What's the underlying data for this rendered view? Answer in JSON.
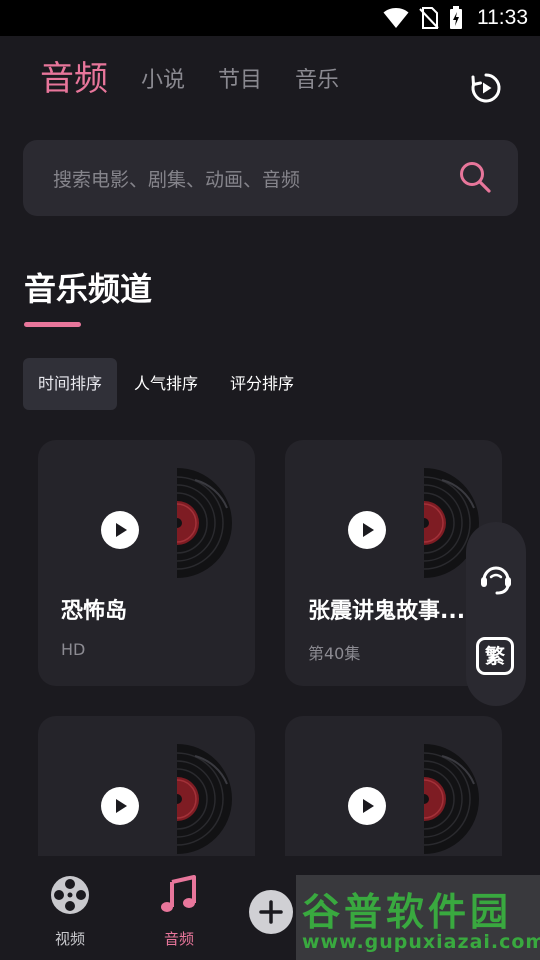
{
  "status_bar": {
    "time": "11:33"
  },
  "tabs": [
    {
      "label": "音频",
      "active": true
    },
    {
      "label": "小说",
      "active": false
    },
    {
      "label": "节目",
      "active": false
    },
    {
      "label": "音乐",
      "active": false
    }
  ],
  "search": {
    "placeholder": "搜索电影、剧集、动画、音频"
  },
  "section": {
    "title": "音乐频道"
  },
  "sort_options": [
    {
      "label": "时间排序",
      "active": true
    },
    {
      "label": "人气排序",
      "active": false
    },
    {
      "label": "评分排序",
      "active": false
    }
  ],
  "cards": [
    {
      "title": "恐怖岛",
      "subtitle": "HD"
    },
    {
      "title": "张震讲鬼故事...",
      "subtitle": "第40集"
    },
    {
      "title": "",
      "subtitle": ""
    },
    {
      "title": "",
      "subtitle": ""
    }
  ],
  "float_bar": {
    "traditional_label": "繁"
  },
  "bottom_nav": [
    {
      "label": "视频",
      "icon": "film-reel-icon",
      "active": false
    },
    {
      "label": "音频",
      "icon": "music-note-icon",
      "active": true
    }
  ],
  "watermark": {
    "title": "谷普软件园",
    "url": "www.gupuxiazai.com"
  },
  "colors": {
    "accent": "#e8769b",
    "background": "#1b1a1f",
    "card": "#25242a",
    "watermark_green": "#39a93f"
  }
}
